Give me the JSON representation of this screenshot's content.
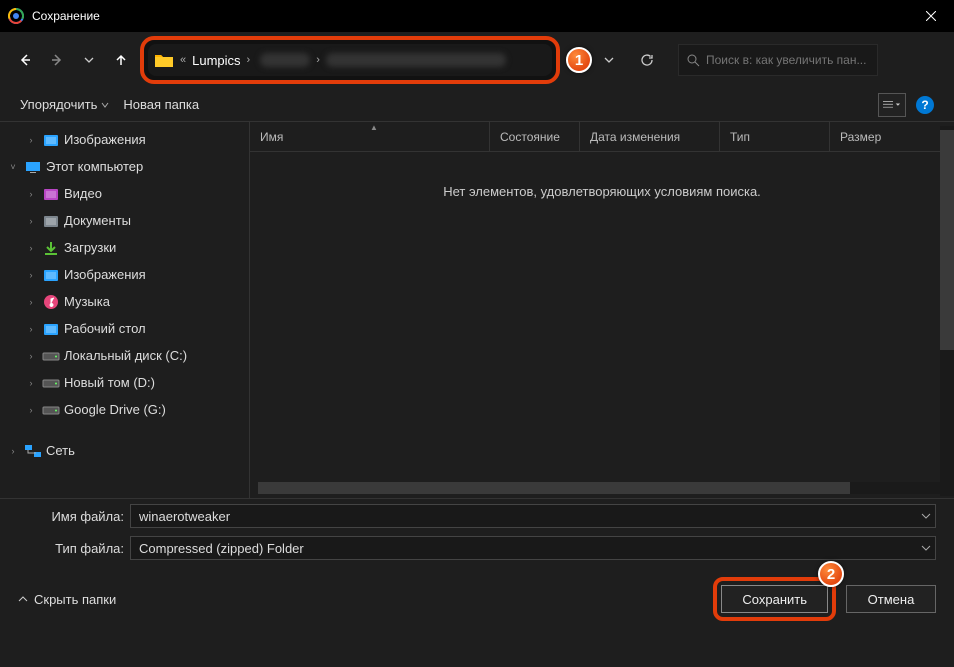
{
  "window": {
    "title": "Сохранение"
  },
  "nav": {
    "crumb1": "Lumpics"
  },
  "search": {
    "placeholder": "Поиск в: как увеличить пан..."
  },
  "toolbar": {
    "organize": "Упорядочить",
    "newfolder": "Новая папка"
  },
  "columns": {
    "name": "Имя",
    "state": "Состояние",
    "modified": "Дата изменения",
    "type": "Тип",
    "size": "Размер"
  },
  "content": {
    "empty": "Нет элементов, удовлетворяющих условиям поиска."
  },
  "sidebar": {
    "items": [
      {
        "exp": ">",
        "lvl": 1,
        "label": "Изображения",
        "icon": "pictures"
      },
      {
        "exp": "v",
        "lvl": 0,
        "label": "Этот компьютер",
        "icon": "pc"
      },
      {
        "exp": ">",
        "lvl": 1,
        "label": "Видео",
        "icon": "video"
      },
      {
        "exp": ">",
        "lvl": 1,
        "label": "Документы",
        "icon": "docs"
      },
      {
        "exp": ">",
        "lvl": 1,
        "label": "Загрузки",
        "icon": "downloads"
      },
      {
        "exp": ">",
        "lvl": 1,
        "label": "Изображения",
        "icon": "pictures"
      },
      {
        "exp": ">",
        "lvl": 1,
        "label": "Музыка",
        "icon": "music"
      },
      {
        "exp": ">",
        "lvl": 1,
        "label": "Рабочий стол",
        "icon": "desktop"
      },
      {
        "exp": ">",
        "lvl": 1,
        "label": "Локальный диск (C:)",
        "icon": "drive"
      },
      {
        "exp": ">",
        "lvl": 1,
        "label": "Новый том (D:)",
        "icon": "drive"
      },
      {
        "exp": ">",
        "lvl": 1,
        "label": "Google Drive (G:)",
        "icon": "drive"
      },
      {
        "exp": ">",
        "lvl": 0,
        "label": "Сеть",
        "icon": "network"
      }
    ]
  },
  "fields": {
    "filename_label": "Имя файла:",
    "filename_value": "winaerotweaker",
    "filetype_label": "Тип файла:",
    "filetype_value": "Compressed (zipped) Folder"
  },
  "buttons": {
    "hide": "Скрыть папки",
    "save": "Сохранить",
    "cancel": "Отмена"
  },
  "markers": {
    "one": "1",
    "two": "2"
  }
}
